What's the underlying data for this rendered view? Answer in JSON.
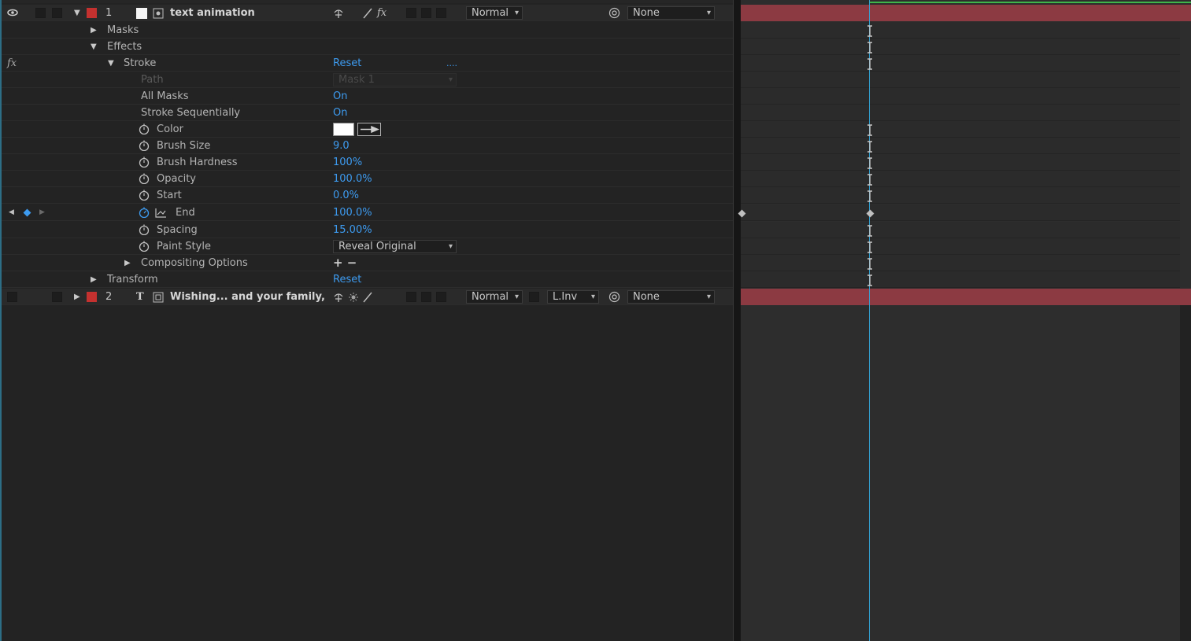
{
  "layer1": {
    "number": "1",
    "name": "text animation",
    "mode": "Normal",
    "parent": "None"
  },
  "masks_label": "Masks",
  "effects_label": "Effects",
  "fx_symbol": "fx",
  "stroke": {
    "name": "Stroke",
    "reset": "Reset",
    "about": "...."
  },
  "properties": [
    {
      "name": "Path",
      "value": "Mask 1"
    },
    {
      "name": "All Masks",
      "value": "On"
    },
    {
      "name": "Stroke Sequentially",
      "value": "On"
    },
    {
      "name": "Color",
      "value": ""
    },
    {
      "name": "Brush Size",
      "value": "9.0"
    },
    {
      "name": "Brush Hardness",
      "value": "100%"
    },
    {
      "name": "Opacity",
      "value": "100.0%"
    },
    {
      "name": "Start",
      "value": "0.0%"
    },
    {
      "name": "End",
      "value": "100.0%"
    },
    {
      "name": "Spacing",
      "value": "15.00%"
    },
    {
      "name": "Paint Style",
      "value": "Reveal Original Image"
    },
    {
      "name": "Compositing Options",
      "value": "+ −"
    }
  ],
  "transform": {
    "label": "Transform",
    "reset": "Reset"
  },
  "layer2": {
    "number": "2",
    "name": "Wishing... and  your family,",
    "mode": "Normal",
    "trkmat": "L.Inv",
    "parent": "None"
  },
  "colors": {
    "label_red": "#c4312f",
    "value_blue": "#3d9bf0",
    "bar": "#8c3a42",
    "playhead": "#33a6d8",
    "green_line": "#3fb54a"
  },
  "icons": [
    "eye-icon",
    "stopwatch-icon",
    "graph-icon",
    "keyframe-nav-icon",
    "parent-pickwhip-icon",
    "color-swatch",
    "eyedropper-icon"
  ]
}
